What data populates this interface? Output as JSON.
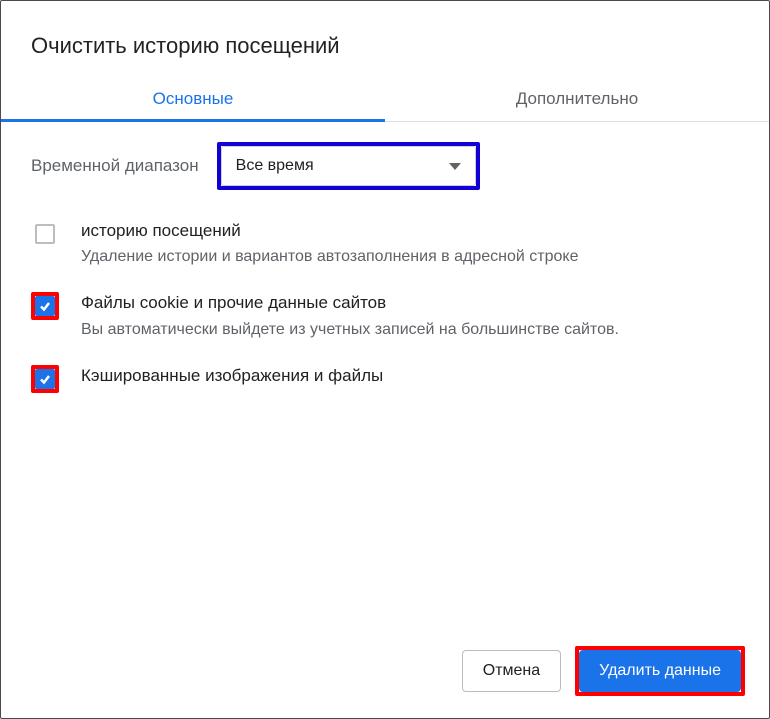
{
  "dialog": {
    "title": "Очистить историю посещений",
    "tabs": {
      "basic": "Основные",
      "advanced": "Дополнительно"
    },
    "range": {
      "label": "Временной диапазон",
      "selected": "Все время"
    },
    "options": {
      "history": {
        "title": "историю посещений",
        "sub": "Удаление истории и вариантов автозаполнения в адресной строке",
        "checked": false
      },
      "cookies": {
        "title": "Файлы cookie и прочие данные сайтов",
        "sub": "Вы автоматически выйдете из учетных записей на большинстве сайтов.",
        "checked": true
      },
      "cache": {
        "title": "Кэшированные изображения и файлы",
        "sub": "",
        "checked": true
      }
    },
    "buttons": {
      "cancel": "Отмена",
      "confirm": "Удалить данные"
    }
  }
}
